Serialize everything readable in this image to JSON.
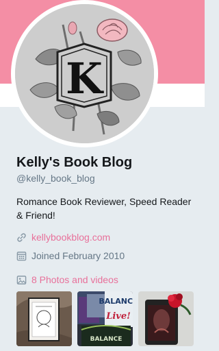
{
  "profile": {
    "name": "Kelly's Book Blog",
    "handle": "@kelly_book_blog",
    "bio": "Romance Book Reviewer, Speed Reader & Friend!",
    "avatar_letter": "K",
    "link_text": "kellybookblog.com",
    "joined_text": "Joined February 2010",
    "photos_text": "8 Photos and videos"
  },
  "thumbnails": [
    {
      "alt_name": "book-on-fur-photo",
      "text": ""
    },
    {
      "alt_name": "balance-book-covers",
      "text_big": "BALANCE",
      "text_live": "Live!"
    },
    {
      "alt_name": "phone-with-rose-photo",
      "text": ""
    }
  ],
  "icons": {
    "link": "link-icon",
    "calendar": "calendar-icon",
    "photos": "image-icon"
  },
  "colors": {
    "banner": "#f48ea5",
    "accent": "#e8709a",
    "background": "#e6ecf0"
  }
}
